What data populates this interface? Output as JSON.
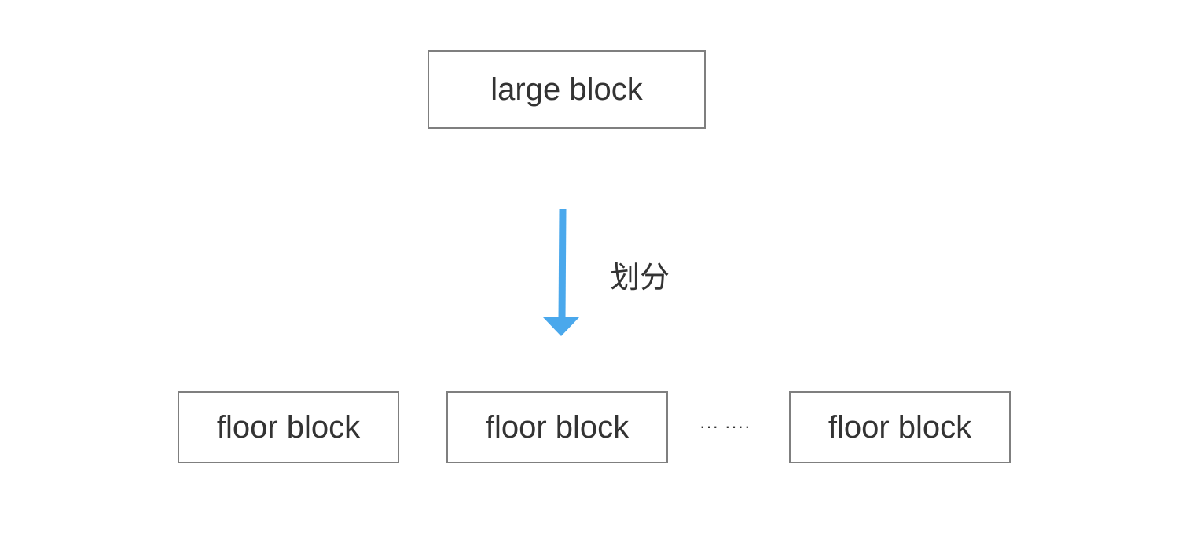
{
  "diagram": {
    "top_block": {
      "label": "large block"
    },
    "arrow": {
      "label": "划分",
      "color": "#4aa8ec"
    },
    "bottom_blocks": [
      {
        "label": "floor block"
      },
      {
        "label": "floor block"
      },
      {
        "label": "floor block"
      }
    ],
    "ellipsis": "··· ····"
  },
  "colors": {
    "box_border": "#7f7f7f",
    "text": "#333333",
    "arrow": "#4aa8ec"
  }
}
